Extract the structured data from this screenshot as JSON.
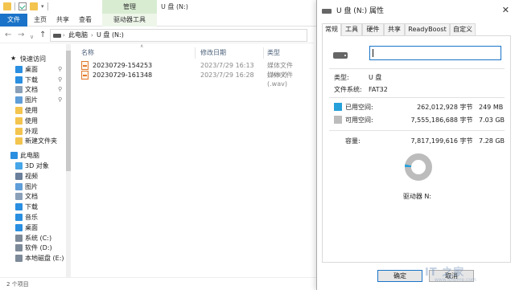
{
  "explorer": {
    "ribbon": {
      "manage_label": "管理",
      "window_title": "U 盘 (N:)",
      "tabs": [
        "文件",
        "主页",
        "共享",
        "查看",
        "驱动器工具"
      ]
    },
    "address": {
      "crumbs": [
        "此电脑",
        "U 盘 (N:)"
      ]
    },
    "columns": {
      "name": "名称",
      "modified": "修改日期",
      "type": "类型"
    },
    "sidebar": {
      "items": [
        {
          "label": "快速访问",
          "icon": "star-icon"
        },
        {
          "label": "桌面",
          "icon": "desktop-icon"
        },
        {
          "label": "下载",
          "icon": "download-icon"
        },
        {
          "label": "文档",
          "icon": "document-icon"
        },
        {
          "label": "图片",
          "icon": "picture-icon"
        },
        {
          "label": "使用",
          "icon": "folder-icon"
        },
        {
          "label": "使用",
          "icon": "folder-icon"
        },
        {
          "label": "外观",
          "icon": "folder-icon"
        },
        {
          "label": "新建文件夹",
          "icon": "folder-icon"
        },
        {
          "label": "此电脑",
          "icon": "computer-icon"
        },
        {
          "label": "3D 对象",
          "icon": "3d-objects-icon"
        },
        {
          "label": "视频",
          "icon": "video-icon"
        },
        {
          "label": "图片",
          "icon": "picture-icon"
        },
        {
          "label": "文档",
          "icon": "document-icon"
        },
        {
          "label": "下载",
          "icon": "download-icon"
        },
        {
          "label": "音乐",
          "icon": "music-icon"
        },
        {
          "label": "桌面",
          "icon": "desktop-icon"
        },
        {
          "label": "系统 (C:)",
          "icon": "drive-icon"
        },
        {
          "label": "软件 (D:)",
          "icon": "drive-icon"
        },
        {
          "label": "本地磁盘 (E:)",
          "icon": "drive-icon"
        }
      ]
    },
    "files": [
      {
        "name": "20230729-154253",
        "modified": "2023/7/29 16:13",
        "type": "媒体文件(.wav)"
      },
      {
        "name": "20230729-161348",
        "modified": "2023/7/29 16:28",
        "type": "媒体文件(.wav)"
      }
    ],
    "status": "2 个项目"
  },
  "dialog": {
    "title": "U 盘 (N:) 属性",
    "tabs": [
      "常规",
      "工具",
      "硬件",
      "共享",
      "ReadyBoost",
      "自定义"
    ],
    "name_value": "",
    "type_label": "类型:",
    "type_value": "U 盘",
    "fs_label": "文件系统:",
    "fs_value": "FAT32",
    "used": {
      "label": "已用空间:",
      "bytes": "262,012,928",
      "unit": "字节",
      "gb": "249 MB",
      "color": "#26a0da"
    },
    "free": {
      "label": "可用空间:",
      "bytes": "7,555,186,688",
      "unit": "字节",
      "gb": "7.03 GB",
      "color": "#bcbcbc"
    },
    "capacity": {
      "label": "容量:",
      "bytes": "7,817,199,616",
      "unit": "字节",
      "gb": "7.28 GB"
    },
    "used_fraction": 0.0335,
    "drive_label": "驱动器 N:",
    "ok_label": "确定",
    "cancel_label": "取消"
  },
  "watermark": {
    "text": "IT 之家",
    "sub": "www.ithome.com"
  }
}
